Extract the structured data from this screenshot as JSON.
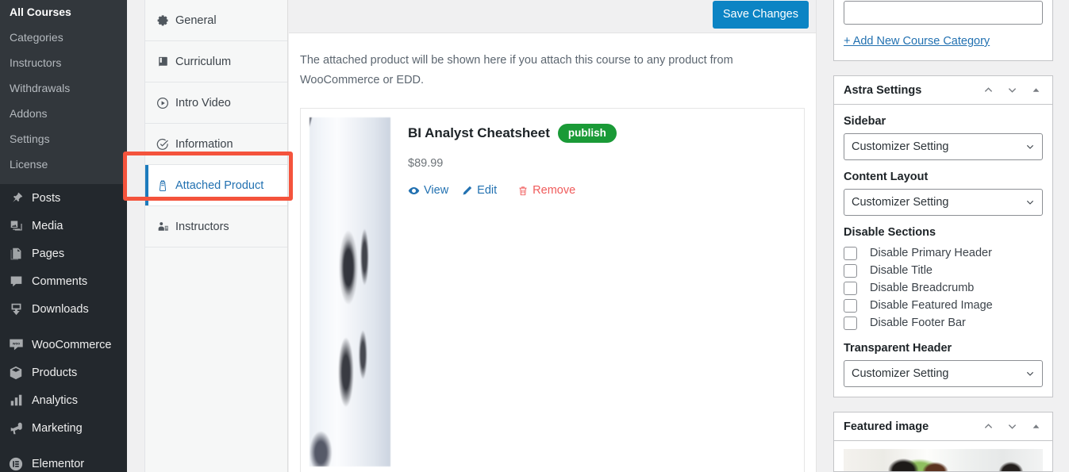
{
  "admin_sidebar": {
    "submenu": [
      {
        "label": "All Courses",
        "current": true
      },
      {
        "label": "Categories",
        "current": false
      },
      {
        "label": "Instructors",
        "current": false
      },
      {
        "label": "Withdrawals",
        "current": false
      },
      {
        "label": "Addons",
        "current": false
      },
      {
        "label": "Settings",
        "current": false
      },
      {
        "label": "License",
        "current": false
      }
    ],
    "menu": [
      {
        "label": "Posts",
        "icon": "pin-icon"
      },
      {
        "label": "Media",
        "icon": "media-icon"
      },
      {
        "label": "Pages",
        "icon": "pages-icon"
      },
      {
        "label": "Comments",
        "icon": "comments-icon"
      },
      {
        "label": "Downloads",
        "icon": "downloads-icon"
      },
      {
        "label": "WooCommerce",
        "icon": "woocommerce-icon"
      },
      {
        "label": "Products",
        "icon": "products-icon"
      },
      {
        "label": "Analytics",
        "icon": "analytics-icon"
      },
      {
        "label": "Marketing",
        "icon": "marketing-icon"
      },
      {
        "label": "Elementor",
        "icon": "elementor-icon"
      }
    ]
  },
  "tabs": [
    {
      "label": "General",
      "icon": "gear-icon",
      "active": false
    },
    {
      "label": "Curriculum",
      "icon": "book-icon",
      "active": false
    },
    {
      "label": "Intro Video",
      "icon": "play-circle-icon",
      "active": false
    },
    {
      "label": "Information",
      "icon": "check-circle-icon",
      "active": false
    },
    {
      "label": "Attached Product",
      "icon": "bag-icon",
      "active": true
    },
    {
      "label": "Instructors",
      "icon": "instructors-icon",
      "active": false
    }
  ],
  "toolbar": {
    "save_label": "Save Changes"
  },
  "content": {
    "intro": "The attached product will be shown here if you attach this course to any product from WooCommerce or EDD.",
    "product": {
      "title": "BI Analyst Cheatsheet",
      "status_badge": "publish",
      "price": "$89.99",
      "view_label": "View",
      "edit_label": "Edit",
      "remove_label": "Remove"
    }
  },
  "right_panel": {
    "category_box": {
      "add_link": "+ Add New Course Category",
      "input_value": ""
    },
    "astra": {
      "title": "Astra Settings",
      "sidebar_label": "Sidebar",
      "sidebar_value": "Customizer Setting",
      "content_layout_label": "Content Layout",
      "content_layout_value": "Customizer Setting",
      "disable_sections_label": "Disable Sections",
      "checkboxes": [
        {
          "label": "Disable Primary Header",
          "checked": false
        },
        {
          "label": "Disable Title",
          "checked": false
        },
        {
          "label": "Disable Breadcrumb",
          "checked": false
        },
        {
          "label": "Disable Featured Image",
          "checked": false
        },
        {
          "label": "Disable Footer Bar",
          "checked": false
        }
      ],
      "transparent_header_label": "Transparent Header",
      "transparent_header_value": "Customizer Setting"
    },
    "featured_image": {
      "title": "Featured image"
    }
  },
  "colors": {
    "accent_blue": "#2271b1",
    "save_button": "#0c84c4",
    "publish_green": "#1a9a37",
    "remove_red": "#f05b5b",
    "highlight_red": "#f4533c",
    "admin_bg": "#23282d",
    "submenu_bg": "#32373c"
  }
}
